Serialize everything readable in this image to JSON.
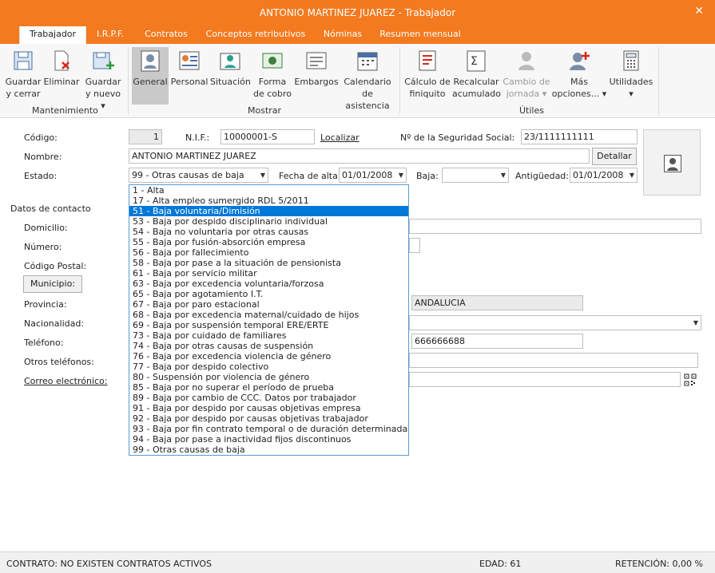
{
  "window": {
    "title": "ANTONIO MARTINEZ JUAREZ - Trabajador"
  },
  "tabs": [
    "Trabajador",
    "I.R.P.F.",
    "Contratos",
    "Conceptos retributivos",
    "Nóminas",
    "Resumen mensual"
  ],
  "ribbon": {
    "guardar_cerrar": [
      "Guardar",
      "y cerrar"
    ],
    "eliminar": "Eliminar",
    "guardar_nuevo": [
      "Guardar",
      "y nuevo ▾"
    ],
    "general": "General",
    "personal": "Personal",
    "situacion": "Situación",
    "forma_cobro": [
      "Forma",
      "de cobro"
    ],
    "embargos": "Embargos",
    "calendario": [
      "Calendario",
      "de asistencia"
    ],
    "finiquito": [
      "Cálculo de",
      "finiquito"
    ],
    "recalcular": [
      "Recalcular",
      "acumulado"
    ],
    "cambio_jornada": [
      "Cambio de",
      "jornada ▾"
    ],
    "mas_opciones": [
      "Más",
      "opciones... ▾"
    ],
    "utilidades": [
      "Utilidades",
      "▾"
    ],
    "groups": {
      "mantenimiento": "Mantenimiento",
      "mostrar": "Mostrar",
      "utiles": "Útiles"
    }
  },
  "form": {
    "codigo_label": "Código:",
    "codigo": "1",
    "nif_label": "N.I.F.:",
    "nif": "10000001-S",
    "localizar": "Localizar",
    "nss_label": "Nº de la Seguridad Social:",
    "nss": "23/1111111111",
    "nombre_label": "Nombre:",
    "nombre": "ANTONIO MARTINEZ JUAREZ",
    "detallar": "Detallar",
    "estado_label": "Estado:",
    "estado": "99 - Otras causas de baja",
    "fecha_alta_label": "Fecha de alta:",
    "fecha_alta": "01/01/2008",
    "baja_label": "Baja:",
    "baja": "",
    "antiguedad_label": "Antigüedad:",
    "antiguedad": "01/01/2008",
    "contacto_title": "Datos de contacto",
    "domicilio_label": "Domicilio:",
    "numero_label": "Número:",
    "cp_label": "Código Postal:",
    "municipio_btn": "Municipio:",
    "provincia_label": "Provincia:",
    "comunidad": "ANDALUCIA",
    "nacionalidad_label": "Nacionalidad:",
    "telefono_label": "Teléfono:",
    "telefono2": "666666688",
    "otros_tel_label": "Otros teléfonos:",
    "correo_label": "Correo electrónico:"
  },
  "dropdown": {
    "options": [
      "1 - Alta",
      "17 - Alta empleo sumergido RDL 5/2011",
      "51 - Baja voluntaria/Dimisión",
      "53 - Baja por despido disciplinario individual",
      "54 - Baja no voluntaria por otras causas",
      "55 - Baja por fusión-absorción empresa",
      "56 - Baja por fallecimiento",
      "58 - Baja por pase a la situación de pensionista",
      "61 - Baja por servicio militar",
      "63 - Baja por excedencia voluntaria/forzosa",
      "65 - Baja por agotamiento I.T.",
      "67 - Baja por paro estacional",
      "68 - Baja por excedencia maternal/cuidado de hijos",
      "69 - Baja por suspensión temporal ERE/ERTE",
      "73 - Baja por cuidado de familiares",
      "74 - Baja por otras causas de suspensión",
      "76 - Baja por excedencia violencia de género",
      "77 - Baja por despido colectivo",
      "80 - Suspensión por violencia de género",
      "85 - Baja por no superar el período de prueba",
      "89 - Baja por cambio de CCC. Datos por trabajador",
      "91 - Baja por despido por causas objetivas empresa",
      "92 - Baja por despido por causas objetivas trabajador",
      "93 - Baja por fin contrato temporal o de duración determinada",
      "94 - Baja por pase a inactividad fijos discontinuos",
      "99 - Otras causas de baja"
    ],
    "highlighted": "51 - Baja voluntaria/Dimisión"
  },
  "status": {
    "contrato": "CONTRATO: NO EXISTEN CONTRATOS ACTIVOS",
    "edad": "EDAD: 61",
    "retencion": "RETENCIÓN: 0,00 %"
  },
  "colors": {
    "accent": "#f47a20",
    "highlight": "#0078d7"
  }
}
